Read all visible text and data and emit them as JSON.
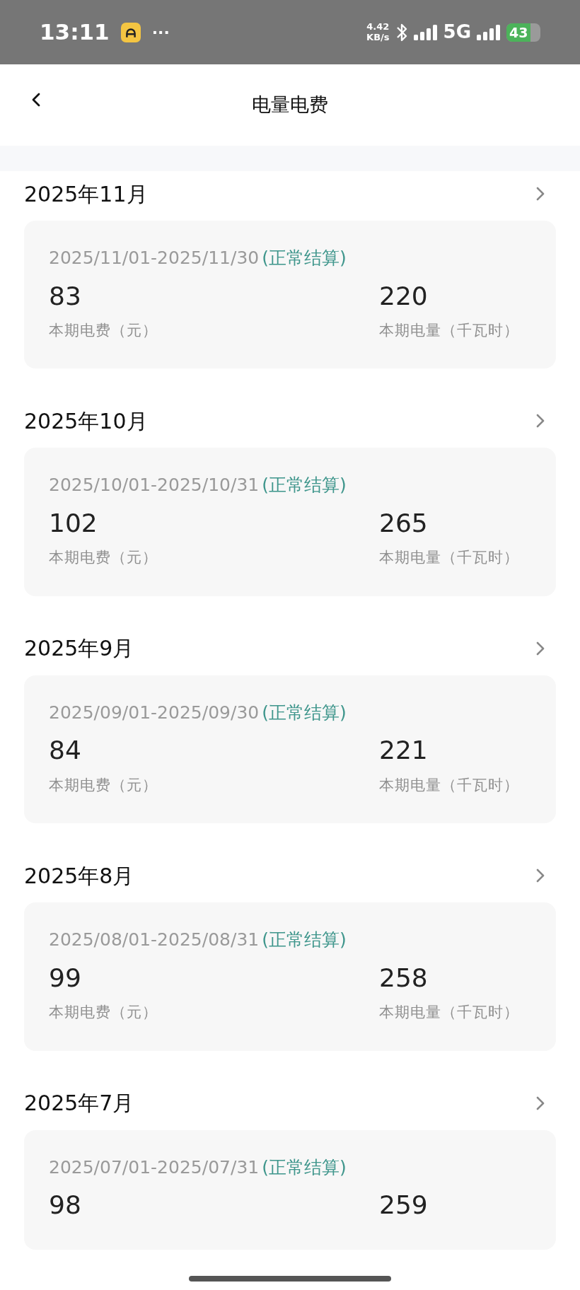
{
  "status_bar": {
    "time": "13:11",
    "more": "···",
    "speed_value": "4.42",
    "speed_unit": "KB/s",
    "network": "5G",
    "battery": "43"
  },
  "header": {
    "title": "电量电费"
  },
  "months": [
    {
      "month": "2025年11月",
      "period": "2025/11/01-2025/11/30",
      "status": "(正常结算)",
      "fee": "83",
      "fee_label": "本期电费（元）",
      "usage": "220",
      "usage_label": "本期电量（千瓦时）"
    },
    {
      "month": "2025年10月",
      "period": "2025/10/01-2025/10/31",
      "status": "(正常结算)",
      "fee": "102",
      "fee_label": "本期电费（元）",
      "usage": "265",
      "usage_label": "本期电量（千瓦时）"
    },
    {
      "month": "2025年9月",
      "period": "2025/09/01-2025/09/30",
      "status": "(正常结算)",
      "fee": "84",
      "fee_label": "本期电费（元）",
      "usage": "221",
      "usage_label": "本期电量（千瓦时）"
    },
    {
      "month": "2025年8月",
      "period": "2025/08/01-2025/08/31",
      "status": "(正常结算)",
      "fee": "99",
      "fee_label": "本期电费（元）",
      "usage": "258",
      "usage_label": "本期电量（千瓦时）"
    },
    {
      "month": "2025年7月",
      "period": "2025/07/01-2025/07/31",
      "status": "(正常结算)",
      "fee": "98",
      "usage": "259"
    }
  ]
}
